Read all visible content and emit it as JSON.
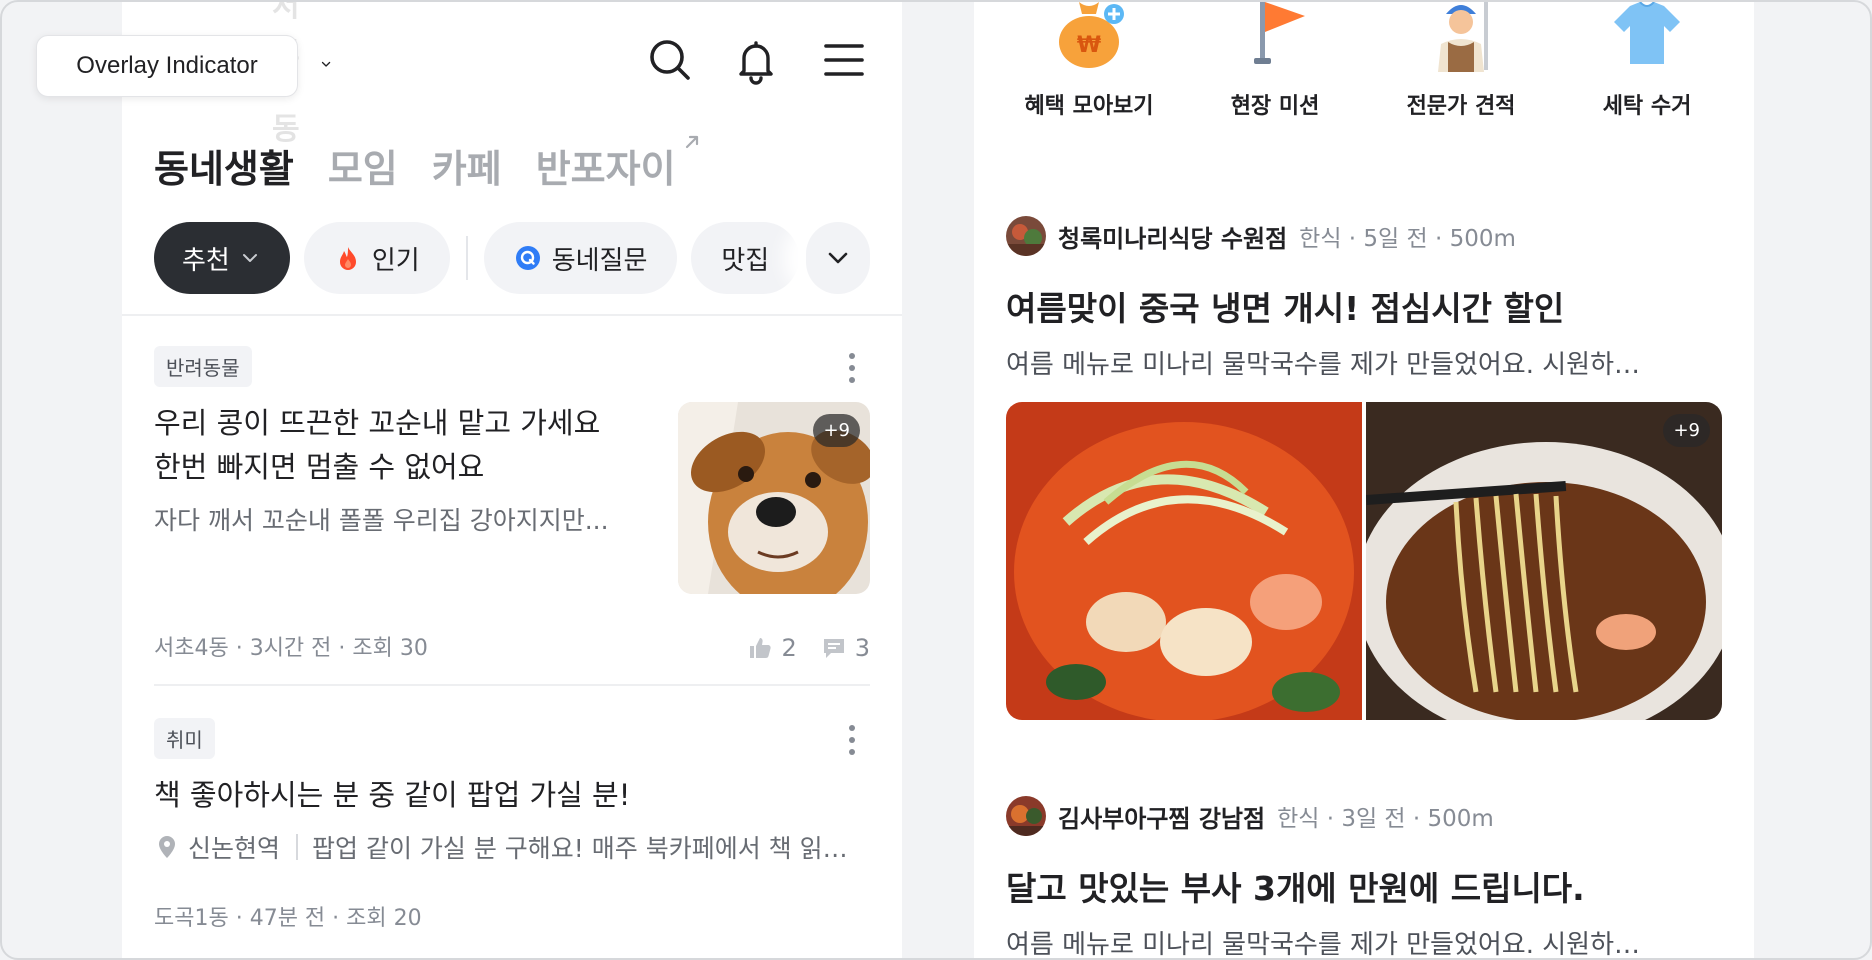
{
  "overlay": {
    "label": "Overlay Indicator"
  },
  "left_panel": {
    "header": {
      "location": "서초4동",
      "icons": [
        "search-icon",
        "bell-icon",
        "menu-icon"
      ]
    },
    "tabs": [
      {
        "label": "동네생활",
        "active": true
      },
      {
        "label": "모임",
        "active": false
      },
      {
        "label": "카페",
        "active": false
      },
      {
        "label": "반포자이",
        "active": false,
        "external": true
      }
    ],
    "chips": {
      "recommended": "추천",
      "popular": "인기",
      "question": "동네질문",
      "restaurant": "맛집"
    },
    "posts": [
      {
        "category": "반려동물",
        "title_line1": "우리 콩이 뜨끈한 꼬순내 맡고 가세요",
        "title_line2": "한번 빠지면 멈출 수 없어요",
        "snippet": "자다 깨서 꼬순내 폴폴 우리집 강아지지만...",
        "image_count": "+9",
        "meta": "서초4동 · 3시간 전 · 조회 30",
        "likes": "2",
        "comments": "3"
      },
      {
        "category": "취미",
        "title": "책 좋아하시는 분 중 같이 팝업 가실 분!",
        "location": "신논현역",
        "snippet": "팝업 같이 가실 분 구해요! 매주 북카페에서 책 읽는 모임이에요",
        "meta": "도곡1동 · 47분 전 · 조회 20"
      }
    ]
  },
  "right_panel": {
    "services": [
      {
        "label": "혜택 모아보기",
        "icon": "money-bag-icon"
      },
      {
        "label": "현장 미션",
        "icon": "flag-icon"
      },
      {
        "label": "전문가 견적",
        "icon": "worker-icon"
      },
      {
        "label": "세탁 수거",
        "icon": "shirt-icon"
      }
    ],
    "feed": [
      {
        "business": "청록미나리식당 수원점",
        "meta": "한식 · 5일 전 · 500m",
        "title": "여름맞이 중국 냉면 개시! 점심시간 할인",
        "snippet": "여름 메뉴로 미나리 물막국수를 제가 만들었어요. 시원하게 드세요",
        "image_count": "+9"
      },
      {
        "business": "김사부아구찜 강남점",
        "meta": "한식 · 3일 전 · 500m",
        "title": "달고 맛있는 부사 3개에 만원에 드립니다.",
        "snippet": "여름 메뉴로 미나리 물막국수를 제가 만들었어요. 시원하게 드세요"
      }
    ]
  },
  "colors": {
    "accent_orange": "#ff6f0f",
    "chip_selected": "#2b2e33",
    "text_primary": "#212124",
    "text_secondary": "#868b94",
    "background": "#f2f3f5"
  }
}
